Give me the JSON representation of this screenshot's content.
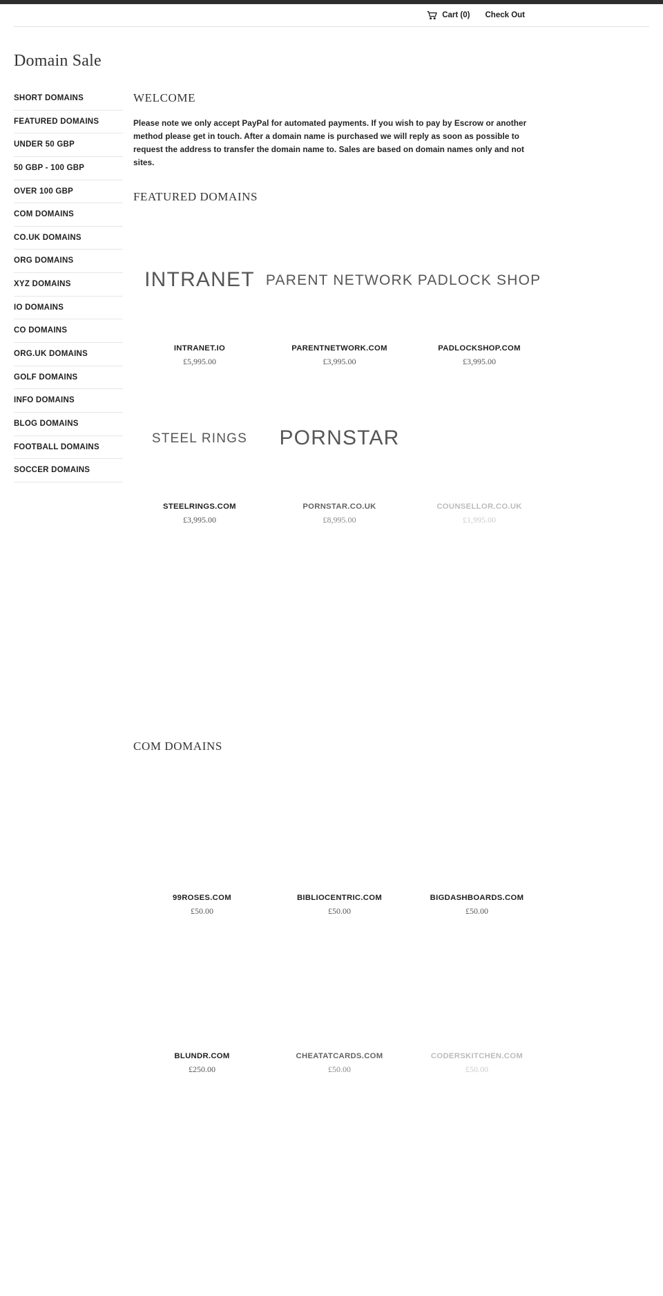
{
  "header": {
    "cart_icon": "shopping-cart-icon",
    "cart_label": "Cart (0)",
    "checkout_label": "Check Out"
  },
  "site_title": "Domain Sale",
  "sidebar": {
    "items": [
      {
        "label": "SHORT DOMAINS"
      },
      {
        "label": "FEATURED DOMAINS"
      },
      {
        "label": "UNDER 50 GBP"
      },
      {
        "label": "50 GBP - 100 GBP"
      },
      {
        "label": "OVER 100 GBP"
      },
      {
        "label": "COM DOMAINS"
      },
      {
        "label": "CO.UK DOMAINS"
      },
      {
        "label": "ORG DOMAINS"
      },
      {
        "label": "XYZ DOMAINS"
      },
      {
        "label": "IO DOMAINS"
      },
      {
        "label": "CO DOMAINS"
      },
      {
        "label": "ORG.UK DOMAINS"
      },
      {
        "label": "GOLF DOMAINS"
      },
      {
        "label": "INFO DOMAINS"
      },
      {
        "label": "BLOG DOMAINS"
      },
      {
        "label": "FOOTBALL DOMAINS"
      },
      {
        "label": "SOCCER DOMAINS"
      }
    ]
  },
  "main": {
    "welcome_heading": "WELCOME",
    "welcome_text": "Please note we only accept PayPal for automated payments. If you wish to pay by Escrow or another method please get in touch. After a domain name is purchased we will reply as soon as possible to request the address to transfer the domain name to. Sales are based on domain names only and not sites.",
    "featured_heading": "FEATURED DOMAINS",
    "featured_products": [
      {
        "wordmark": "INTRANET",
        "name": "INTRANET.IO",
        "price": "£5,995.00"
      },
      {
        "wordmark": "PARENT NETWORK",
        "name": "PARENTNETWORK.COM",
        "price": "£3,995.00"
      },
      {
        "wordmark": "PADLOCK SHOP",
        "name": "PADLOCKSHOP.COM",
        "price": "£3,995.00"
      },
      {
        "wordmark": "STEEL RINGS",
        "name": "STEELRINGS.COM",
        "price": "£3,995.00"
      },
      {
        "wordmark": "PORNSTAR",
        "name": "PORNSTAR.CO.UK",
        "price": "£8,995.00"
      },
      {
        "wordmark": "",
        "name": "COUNSELLOR.CO.UK",
        "price": "£1,995.00"
      }
    ],
    "com_heading": "COM DOMAINS",
    "com_products": [
      {
        "wordmark": "",
        "name": "99ROSES.COM",
        "price": "£50.00"
      },
      {
        "wordmark": "",
        "name": "BIBLIOCENTRIC.COM",
        "price": "£50.00"
      },
      {
        "wordmark": "",
        "name": "BIGDASHBOARDS.COM",
        "price": "£50.00"
      },
      {
        "wordmark": "",
        "name": "BLUNDR.COM",
        "price": "£250.00"
      },
      {
        "wordmark": "",
        "name": "CHEATATCARDS.COM",
        "price": "£50.00"
      },
      {
        "wordmark": "",
        "name": "CODERSKITCHEN.COM",
        "price": "£50.00"
      }
    ]
  }
}
